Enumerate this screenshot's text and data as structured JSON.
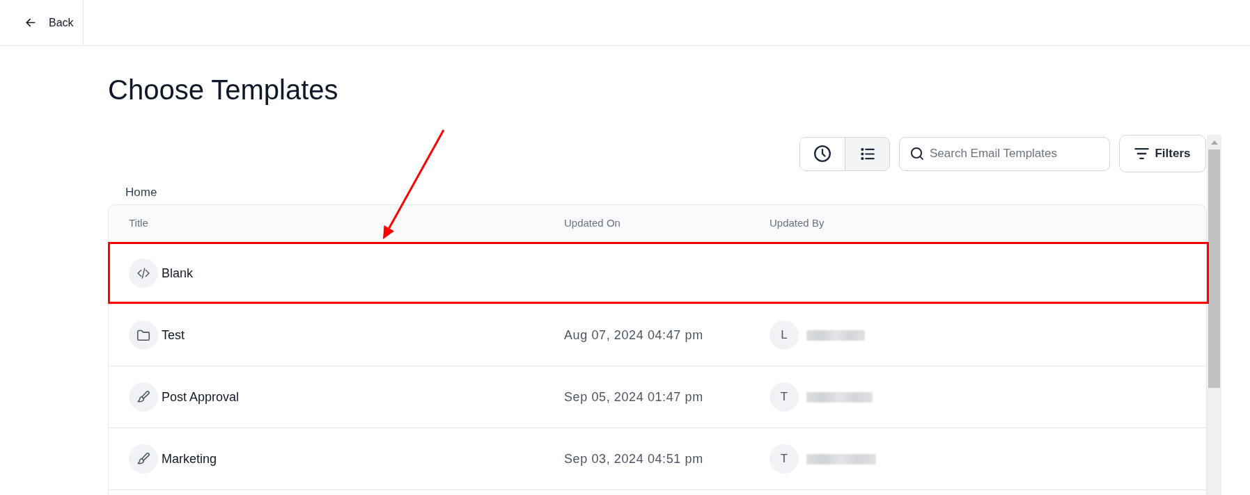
{
  "header": {
    "back_label": "Back"
  },
  "page": {
    "title": "Choose Templates"
  },
  "toolbar": {
    "view_toggle": [
      {
        "kind": "recent",
        "selected": false
      },
      {
        "kind": "list",
        "selected": true
      }
    ],
    "search": {
      "placeholder": "Search Email Templates"
    },
    "filters_label": "Filters"
  },
  "breadcrumb": [
    "Home"
  ],
  "table": {
    "columns": [
      "Title",
      "Updated On",
      "Updated By"
    ],
    "rows": [
      {
        "kind": "blank",
        "title": "Blank",
        "highlighted": true
      },
      {
        "kind": "folder",
        "title": "Test",
        "updated_on": "Aug 07, 2024 04:47 pm",
        "updated_by_initial": "L",
        "highlighted": false
      },
      {
        "kind": "template",
        "title": "Post Approval",
        "updated_on": "Sep 05, 2024 01:47 pm",
        "updated_by_initial": "T",
        "highlighted": false
      },
      {
        "kind": "template",
        "title": "Marketing",
        "updated_on": "Sep 03, 2024 04:51 pm",
        "updated_by_initial": "T",
        "highlighted": false
      }
    ]
  }
}
